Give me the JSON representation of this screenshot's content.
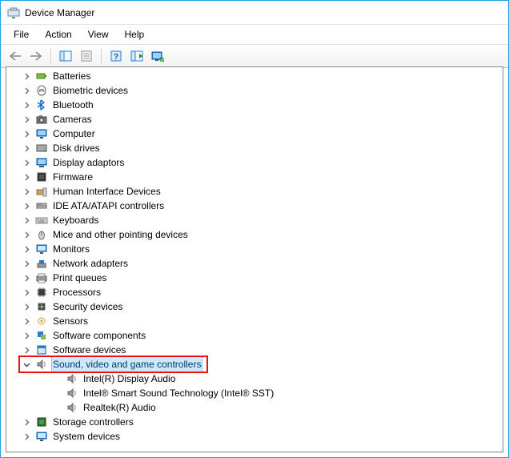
{
  "window": {
    "title": "Device Manager"
  },
  "menu": {
    "file": "File",
    "action": "Action",
    "view": "View",
    "help": "Help"
  },
  "toolbar": {
    "back": "back",
    "forward": "forward",
    "show": "show-hide-console-tree",
    "properties": "properties",
    "help": "help",
    "refresh": "action-refresh",
    "monitor": "scan-hardware"
  },
  "tree": [
    {
      "label": "Batteries",
      "icon": "battery",
      "expanded": false,
      "depth": 1
    },
    {
      "label": "Biometric devices",
      "icon": "finger",
      "expanded": false,
      "depth": 1
    },
    {
      "label": "Bluetooth",
      "icon": "bluetooth",
      "expanded": false,
      "depth": 1
    },
    {
      "label": "Cameras",
      "icon": "camera",
      "expanded": false,
      "depth": 1
    },
    {
      "label": "Computer",
      "icon": "computer",
      "expanded": false,
      "depth": 1
    },
    {
      "label": "Disk drives",
      "icon": "disk",
      "expanded": false,
      "depth": 1
    },
    {
      "label": "Display adaptors",
      "icon": "display",
      "expanded": false,
      "depth": 1
    },
    {
      "label": "Firmware",
      "icon": "firmware",
      "expanded": false,
      "depth": 1
    },
    {
      "label": "Human Interface Devices",
      "icon": "hid",
      "expanded": false,
      "depth": 1
    },
    {
      "label": "IDE ATA/ATAPI controllers",
      "icon": "ide",
      "expanded": false,
      "depth": 1
    },
    {
      "label": "Keyboards",
      "icon": "keyboard",
      "expanded": false,
      "depth": 1
    },
    {
      "label": "Mice and other pointing devices",
      "icon": "mouse",
      "expanded": false,
      "depth": 1
    },
    {
      "label": "Monitors",
      "icon": "monitor",
      "expanded": false,
      "depth": 1
    },
    {
      "label": "Network adapters",
      "icon": "network",
      "expanded": false,
      "depth": 1
    },
    {
      "label": "Print queues",
      "icon": "printer",
      "expanded": false,
      "depth": 1
    },
    {
      "label": "Processors",
      "icon": "cpu",
      "expanded": false,
      "depth": 1
    },
    {
      "label": "Security devices",
      "icon": "security",
      "expanded": false,
      "depth": 1
    },
    {
      "label": "Sensors",
      "icon": "sensor",
      "expanded": false,
      "depth": 1
    },
    {
      "label": "Software components",
      "icon": "swcomp",
      "expanded": false,
      "depth": 1
    },
    {
      "label": "Software devices",
      "icon": "swdev",
      "expanded": false,
      "depth": 1
    },
    {
      "label": "Sound, video and game controllers",
      "icon": "sound",
      "expanded": true,
      "depth": 1,
      "selected": true,
      "highlighted": true
    },
    {
      "label": "Intel(R) Display Audio",
      "icon": "sound",
      "leaf": true,
      "depth": 2
    },
    {
      "label": "Intel® Smart Sound Technology (Intel® SST)",
      "icon": "sound",
      "leaf": true,
      "depth": 2
    },
    {
      "label": "Realtek(R) Audio",
      "icon": "sound",
      "leaf": true,
      "depth": 2
    },
    {
      "label": "Storage controllers",
      "icon": "storage",
      "expanded": false,
      "depth": 1
    },
    {
      "label": "System devices",
      "icon": "system",
      "expanded": false,
      "depth": 1
    }
  ]
}
